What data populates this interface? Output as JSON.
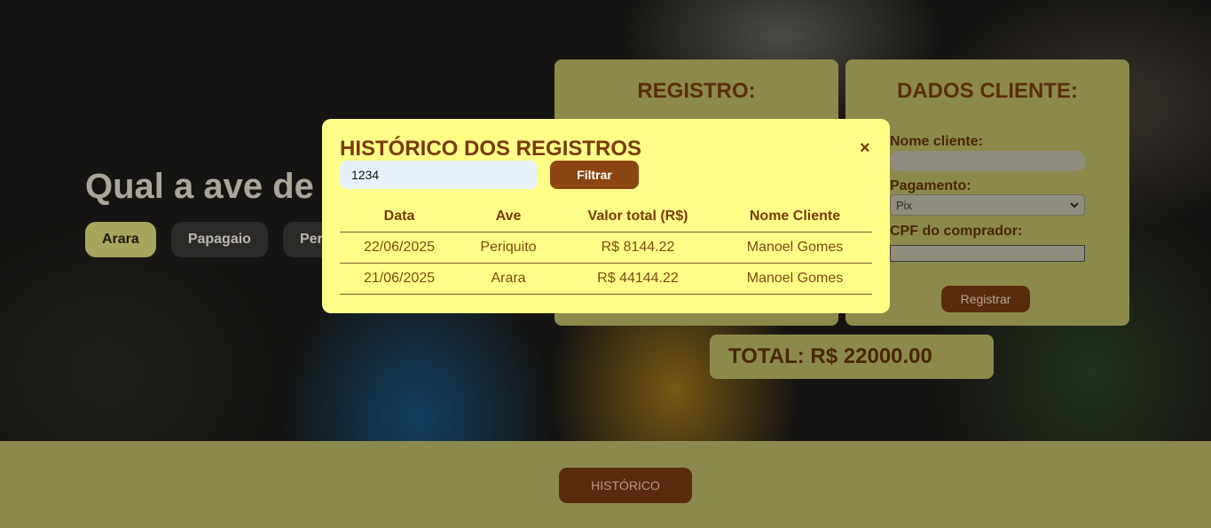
{
  "hero": {
    "title": "Qual a ave de",
    "chips": [
      "Arara",
      "Papagaio",
      "Per"
    ],
    "active_chip": "Arara"
  },
  "registro": {
    "title": "REGISTRO:"
  },
  "dados_cliente": {
    "title": "DADOS CLIENTE:",
    "name_label": "Nome cliente:",
    "name_value": "",
    "payment_label": "Pagamento:",
    "payment_selected": "Pix",
    "cpf_label": "CPF do comprador:",
    "cpf_value": "",
    "submit_label": "Registrar"
  },
  "total": {
    "text": "TOTAL: R$ 22000.00"
  },
  "footer": {
    "history_button": "HISTÓRICO"
  },
  "modal": {
    "title": "HISTÓRICO DOS REGISTROS",
    "close_glyph": "×",
    "filter_value": "1234",
    "filter_button": "Filtrar",
    "columns": [
      "Data",
      "Ave",
      "Valor total (R$)",
      "Nome Cliente"
    ],
    "rows": [
      [
        "22/06/2025",
        "Periquito",
        "R$ 8144.22",
        "Manoel Gomes"
      ],
      [
        "21/06/2025",
        "Arara",
        "R$ 44144.22",
        "Manoel Gomes"
      ]
    ]
  },
  "colors": {
    "card": "#8c8a4a",
    "modal_bg": "#ffff87",
    "brown_button": "#5a2a0c",
    "filter_button": "#8b4513",
    "active_chip": "#a8a65e"
  }
}
